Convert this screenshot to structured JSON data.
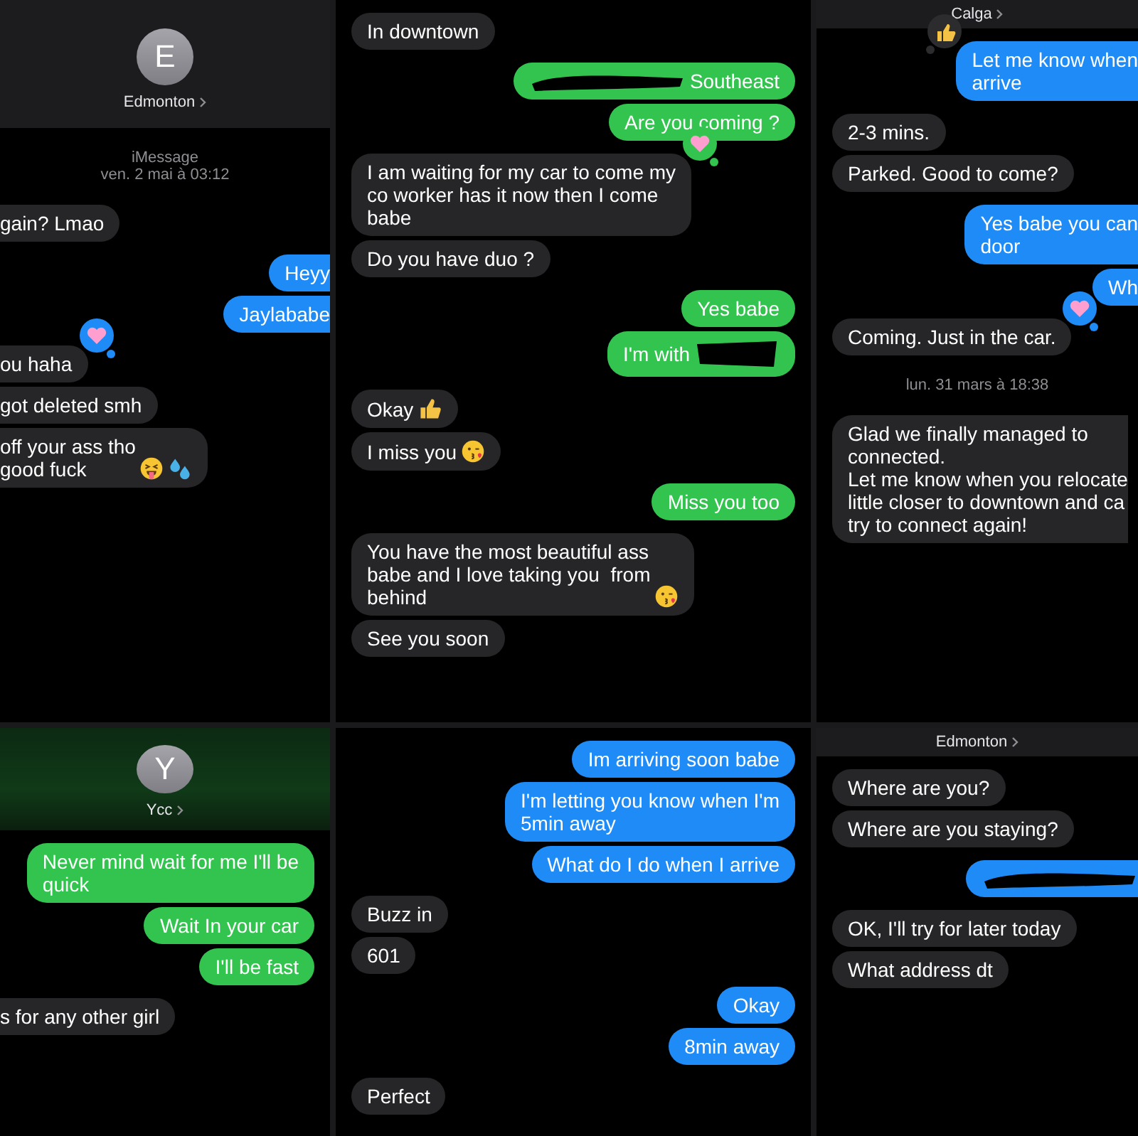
{
  "panels": [
    {
      "sms": false,
      "header": {
        "avatar": "E",
        "name": "Edmonton",
        "green_tint": false,
        "compact": false
      },
      "items": [
        {
          "kind": "stamp",
          "service_label": "iMessage",
          "time": "ven. 2 mai à 03:12"
        },
        {
          "kind": "message",
          "from_me": false,
          "text": "gain? Lmao",
          "cut_left": true
        },
        {
          "kind": "message",
          "from_me": true,
          "text": "Heyy",
          "cut_right": true
        },
        {
          "kind": "message",
          "from_me": true,
          "text": "Jaylababe",
          "cut_right": true
        },
        {
          "kind": "message",
          "from_me": false,
          "text": "ou haha",
          "cut_left": true,
          "reaction": {
            "kind": "heart",
            "by_me": true
          }
        },
        {
          "kind": "message",
          "from_me": false,
          "text": "got deleted smh",
          "cut_left": true
        },
        {
          "kind": "message",
          "from_me": false,
          "text": "off your ass tho\ngood fuck",
          "cut_left": true,
          "emoji": [
            {
              "kind": "tongue"
            },
            {
              "kind": "drops"
            }
          ]
        }
      ]
    },
    {
      "sms": true,
      "items": [
        {
          "kind": "message",
          "from_me": false,
          "text": "In downtown"
        },
        {
          "kind": "message",
          "from_me": true,
          "text": "Southeast",
          "redaction": {
            "kind": "before"
          }
        },
        {
          "kind": "message",
          "from_me": true,
          "text": "Are you coming ?"
        },
        {
          "kind": "message",
          "from_me": false,
          "text": "I am waiting for my car to come my\nco worker has it now then I come\nbabe",
          "reaction": {
            "kind": "heart",
            "by_me": true
          }
        },
        {
          "kind": "message",
          "from_me": false,
          "text": "Do you have duo ?"
        },
        {
          "kind": "message",
          "from_me": true,
          "text": "Yes babe"
        },
        {
          "kind": "message",
          "from_me": true,
          "text": "I'm with",
          "redaction": {
            "kind": "after"
          }
        },
        {
          "kind": "message",
          "from_me": false,
          "text": "Okay",
          "emoji": [
            {
              "kind": "thumbs"
            }
          ]
        },
        {
          "kind": "message",
          "from_me": false,
          "text": "I miss you",
          "emoji": [
            {
              "kind": "kiss"
            }
          ]
        },
        {
          "kind": "message",
          "from_me": true,
          "text": "Miss you too"
        },
        {
          "kind": "message",
          "from_me": false,
          "text": "You have the most beautiful ass\nbabe and I love taking you  from\nbehind",
          "emoji": [
            {
              "kind": "kiss"
            }
          ]
        },
        {
          "kind": "message",
          "from_me": false,
          "text": "See you soon"
        }
      ]
    },
    {
      "sms": false,
      "header": {
        "name": "Calga",
        "green_tint": false,
        "compact": true
      },
      "items": [
        {
          "kind": "message",
          "from_me": true,
          "text": "Let me know when\narrive",
          "cut_right": true,
          "reaction": {
            "kind": "thumbs",
            "by_me": false
          }
        },
        {
          "kind": "message",
          "from_me": false,
          "text": "2-3 mins."
        },
        {
          "kind": "message",
          "from_me": false,
          "text": "Parked. Good to come?"
        },
        {
          "kind": "message",
          "from_me": true,
          "text": "Yes babe you can\ndoor",
          "cut_right": true
        },
        {
          "kind": "message",
          "from_me": true,
          "text": "Wh",
          "cut_right": true
        },
        {
          "kind": "message",
          "from_me": false,
          "text": "Coming. Just in the car.",
          "reaction": {
            "kind": "heart",
            "by_me": true
          }
        },
        {
          "kind": "stamp",
          "time": "lun. 31 mars à 18:38"
        },
        {
          "kind": "message",
          "from_me": false,
          "text": "Glad we finally managed to\nconnected.\nLet me know when you relocate\nlittle closer to downtown and ca\ntry to connect again!",
          "cut_right": true
        }
      ]
    },
    {
      "sms": true,
      "header": {
        "avatar": "Y",
        "name": "Ycc",
        "green_tint": true,
        "compact": false
      },
      "items": [
        {
          "kind": "message",
          "from_me": true,
          "text": "Never mind wait for me I'll be\nquick"
        },
        {
          "kind": "message",
          "from_me": true,
          "text": "Wait In your car"
        },
        {
          "kind": "message",
          "from_me": true,
          "text": "I'll be fast"
        },
        {
          "kind": "message",
          "from_me": false,
          "text": "s for any other girl",
          "cut_left": true
        }
      ]
    },
    {
      "sms": false,
      "items": [
        {
          "kind": "message",
          "from_me": true,
          "text": "Im arriving soon babe"
        },
        {
          "kind": "message",
          "from_me": true,
          "text": "I'm letting you know when I'm\n5min away"
        },
        {
          "kind": "message",
          "from_me": true,
          "text": "What do I do when I arrive"
        },
        {
          "kind": "message",
          "from_me": false,
          "text": "Buzz in"
        },
        {
          "kind": "message",
          "from_me": false,
          "text": "601"
        },
        {
          "kind": "message",
          "from_me": true,
          "text": "Okay"
        },
        {
          "kind": "message",
          "from_me": true,
          "text": "8min away"
        },
        {
          "kind": "message",
          "from_me": false,
          "text": "Perfect"
        }
      ]
    },
    {
      "sms": false,
      "header": {
        "name": "Edmonton",
        "green_tint": false,
        "compact": true
      },
      "items": [
        {
          "kind": "message",
          "from_me": false,
          "text": "Where are you?"
        },
        {
          "kind": "message",
          "from_me": false,
          "text": "Where are you staying?"
        },
        {
          "kind": "message",
          "from_me": true,
          "redaction": {
            "kind": "whole"
          },
          "cut_right": true
        },
        {
          "kind": "message",
          "from_me": false,
          "text": "OK, I'll try for later today"
        },
        {
          "kind": "message",
          "from_me": false,
          "text": "What address dt"
        }
      ]
    }
  ]
}
